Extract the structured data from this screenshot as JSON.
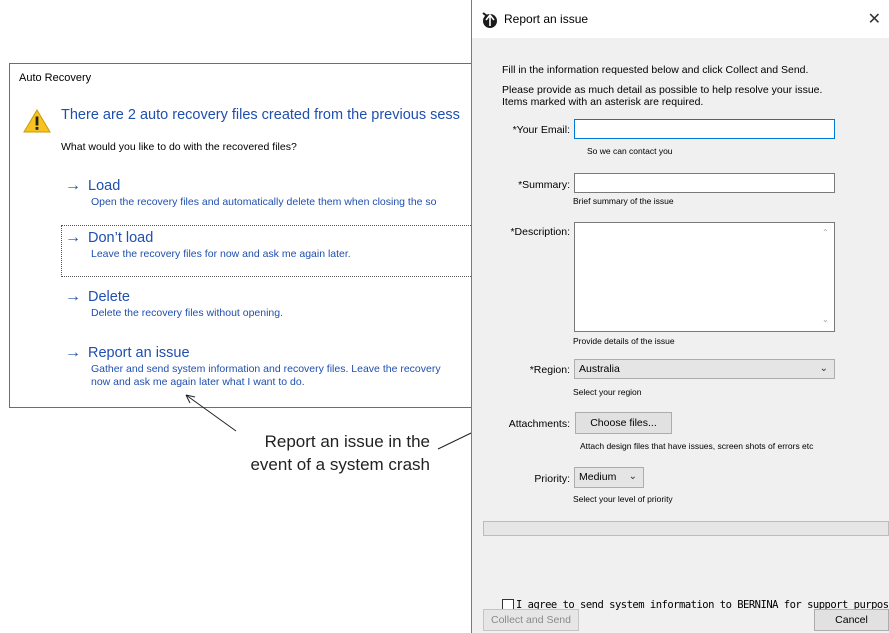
{
  "auto_recovery": {
    "title": "Auto Recovery",
    "heading": "There are 2 auto recovery files created from the  previous sess",
    "question": "What would you like to do with the recovered files?",
    "options": [
      {
        "label": "Load",
        "description": "Open the recovery files and automatically delete them when closing the so"
      },
      {
        "label": "Don’t load",
        "description": "Leave the recovery files for now and ask me again later."
      },
      {
        "label": "Delete",
        "description": "Delete the recovery files without opening."
      },
      {
        "label": "Report an issue",
        "description": "Gather and send system information and recovery files. Leave the recovery",
        "description2": "now and ask me again later what I want to do."
      }
    ],
    "arrow_icon": "right-arrow-icon",
    "accent_color": "#1f4faf"
  },
  "callout": {
    "line1": "Report an issue in the",
    "line2": "event of a system crash"
  },
  "report_issue": {
    "title": "Report an issue",
    "intro": "Fill in the information requested below and click Collect and Send.",
    "intro2_line1": "Please provide as much detail as possible to help resolve your issue.",
    "intro2_line2": "Items marked with an asterisk are required.",
    "email": {
      "label": "*Your Email:",
      "value": "",
      "hint": "So we can contact you"
    },
    "summary": {
      "label": "*Summary:",
      "value": "",
      "hint": "Brief summary of the issue"
    },
    "description": {
      "label": "*Description:",
      "value": "",
      "hint": "Provide details of the issue"
    },
    "region": {
      "label": "*Region:",
      "value": "Australia",
      "hint": "Select your region"
    },
    "attachments": {
      "label": "Attachments:",
      "button": "Choose files...",
      "hint": "Attach design files that have issues, screen shots of errors etc"
    },
    "priority": {
      "label": "Priority:",
      "value": "Medium",
      "hint": "Select your level of priority"
    },
    "progress_percent": 0,
    "agree": {
      "checked": false,
      "label": "I agree to send system information to BERNINA for support purposes."
    },
    "collect_button": "Collect and Send",
    "cancel_button": "Cancel",
    "close_icon": "close-icon",
    "logo_icon": "bernina-logo-icon"
  }
}
